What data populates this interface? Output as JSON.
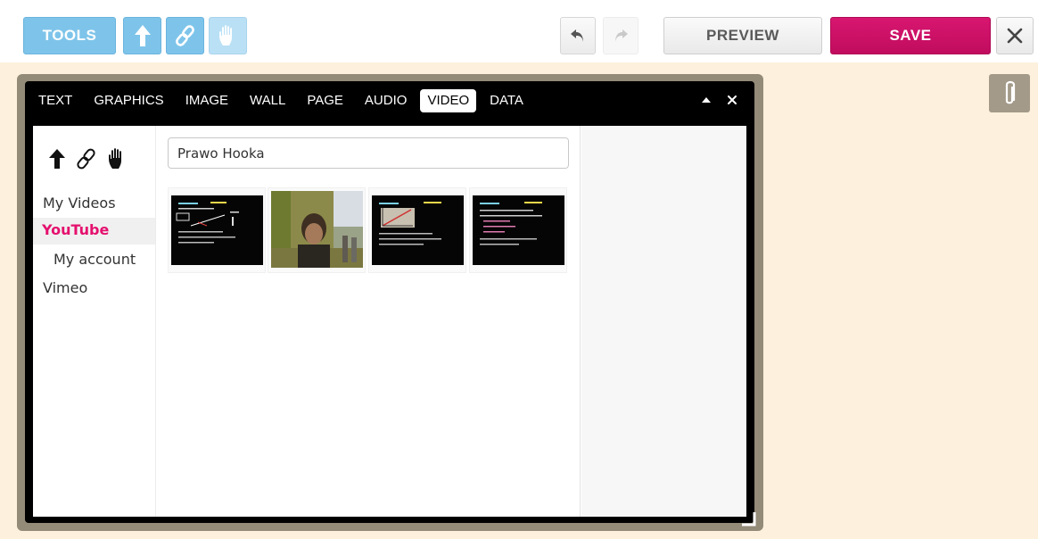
{
  "toolbar": {
    "tools_label": "TOOLS",
    "upload_icon": "arrow-up-icon",
    "link_icon": "chain-link-icon",
    "hand_icon": "hand-icon",
    "undo_icon": "undo-arrow-icon",
    "redo_icon": "redo-arrow-icon",
    "preview_label": "PREVIEW",
    "save_label": "SAVE",
    "close_icon": "close-x-icon"
  },
  "panel": {
    "tabs": [
      {
        "label": "TEXT"
      },
      {
        "label": "GRAPHICS"
      },
      {
        "label": "IMAGE"
      },
      {
        "label": "WALL"
      },
      {
        "label": "PAGE"
      },
      {
        "label": "AUDIO"
      },
      {
        "label": "VIDEO",
        "active": true
      },
      {
        "label": "DATA"
      }
    ],
    "sidebar": {
      "items": [
        {
          "label": "My Videos"
        },
        {
          "label": "YouTube",
          "active": true
        },
        {
          "label": "My account"
        },
        {
          "label": "Vimeo"
        }
      ]
    },
    "search": {
      "value": "Prawo Hooka"
    },
    "thumbnails": [
      {
        "kind": "slide"
      },
      {
        "kind": "photo"
      },
      {
        "kind": "graph-slide"
      },
      {
        "kind": "text-slide"
      }
    ]
  },
  "colors": {
    "accent_blue": "#7ec4ea",
    "save_pink": "#c8105f",
    "youtube_pink": "#e5106e",
    "canvas_bg": "#fdf1dd",
    "panel_frame": "#938a78"
  }
}
